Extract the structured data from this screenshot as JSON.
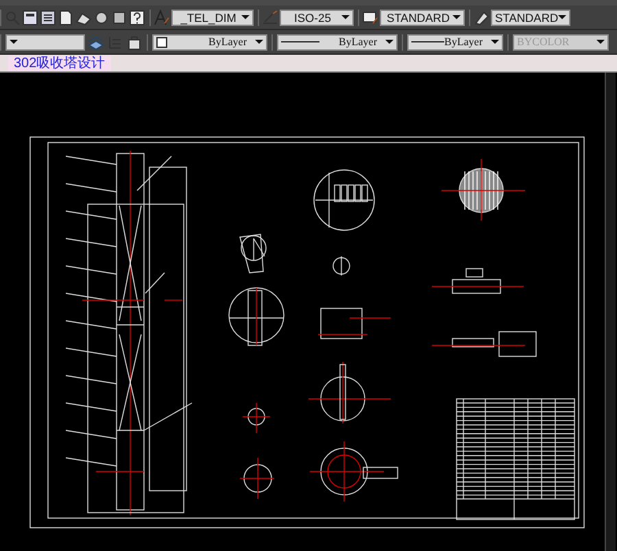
{
  "toolbar_styles": {
    "dropdowns": [
      {
        "kind": "text-style",
        "value": "_TEL_DIM"
      },
      {
        "kind": "dim-style",
        "value": "ISO-25"
      },
      {
        "kind": "table-style",
        "value": "STANDARD"
      },
      {
        "kind": "multileader-style",
        "value": "STANDARD"
      }
    ]
  },
  "toolbar_properties": {
    "dropdowns": [
      {
        "kind": "color",
        "value": "ByLayer",
        "disabled": false
      },
      {
        "kind": "linetype",
        "value": "ByLayer",
        "disabled": false
      },
      {
        "kind": "lineweight",
        "value": "ByLayer",
        "disabled": false
      },
      {
        "kind": "plotstyle",
        "value": "BYCOLOR",
        "disabled": true
      }
    ]
  },
  "tabs": [
    {
      "label": "302吸收塔设计",
      "selected": true
    }
  ]
}
